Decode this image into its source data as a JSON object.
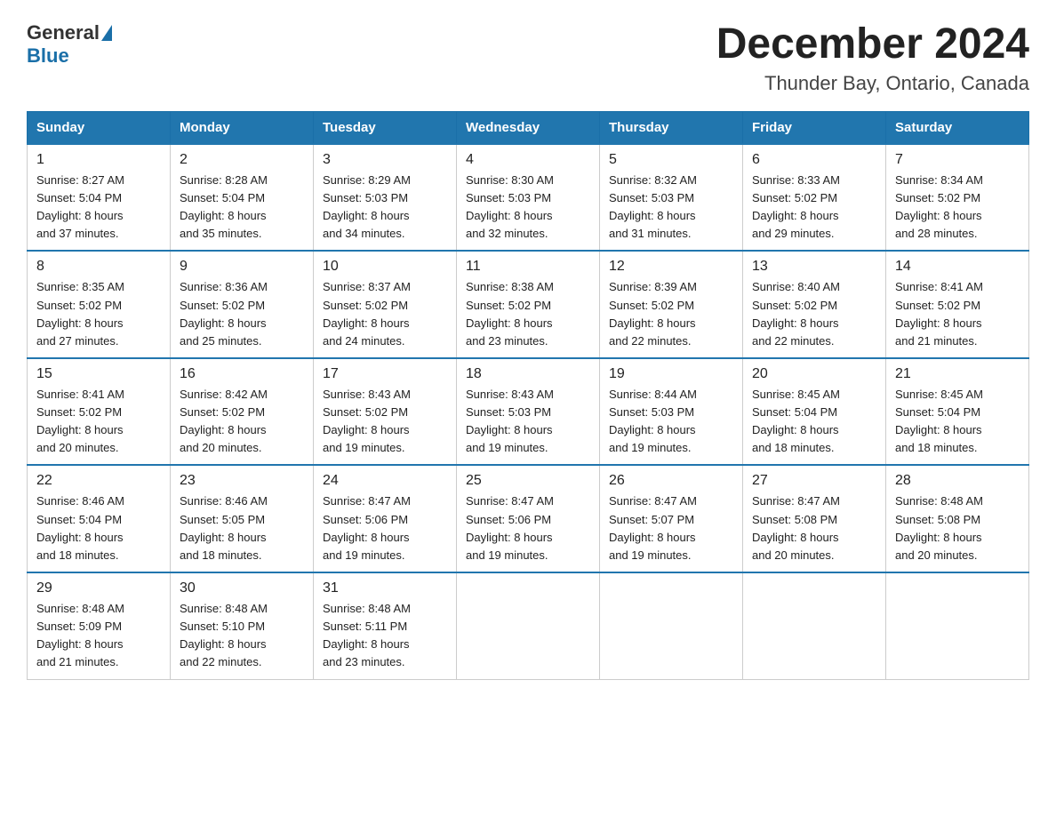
{
  "logo": {
    "general": "General",
    "blue": "Blue"
  },
  "title": "December 2024",
  "location": "Thunder Bay, Ontario, Canada",
  "weekdays": [
    "Sunday",
    "Monday",
    "Tuesday",
    "Wednesday",
    "Thursday",
    "Friday",
    "Saturday"
  ],
  "weeks": [
    [
      {
        "day": "1",
        "sunrise": "8:27 AM",
        "sunset": "5:04 PM",
        "daylight": "8 hours and 37 minutes."
      },
      {
        "day": "2",
        "sunrise": "8:28 AM",
        "sunset": "5:04 PM",
        "daylight": "8 hours and 35 minutes."
      },
      {
        "day": "3",
        "sunrise": "8:29 AM",
        "sunset": "5:03 PM",
        "daylight": "8 hours and 34 minutes."
      },
      {
        "day": "4",
        "sunrise": "8:30 AM",
        "sunset": "5:03 PM",
        "daylight": "8 hours and 32 minutes."
      },
      {
        "day": "5",
        "sunrise": "8:32 AM",
        "sunset": "5:03 PM",
        "daylight": "8 hours and 31 minutes."
      },
      {
        "day": "6",
        "sunrise": "8:33 AM",
        "sunset": "5:02 PM",
        "daylight": "8 hours and 29 minutes."
      },
      {
        "day": "7",
        "sunrise": "8:34 AM",
        "sunset": "5:02 PM",
        "daylight": "8 hours and 28 minutes."
      }
    ],
    [
      {
        "day": "8",
        "sunrise": "8:35 AM",
        "sunset": "5:02 PM",
        "daylight": "8 hours and 27 minutes."
      },
      {
        "day": "9",
        "sunrise": "8:36 AM",
        "sunset": "5:02 PM",
        "daylight": "8 hours and 25 minutes."
      },
      {
        "day": "10",
        "sunrise": "8:37 AM",
        "sunset": "5:02 PM",
        "daylight": "8 hours and 24 minutes."
      },
      {
        "day": "11",
        "sunrise": "8:38 AM",
        "sunset": "5:02 PM",
        "daylight": "8 hours and 23 minutes."
      },
      {
        "day": "12",
        "sunrise": "8:39 AM",
        "sunset": "5:02 PM",
        "daylight": "8 hours and 22 minutes."
      },
      {
        "day": "13",
        "sunrise": "8:40 AM",
        "sunset": "5:02 PM",
        "daylight": "8 hours and 22 minutes."
      },
      {
        "day": "14",
        "sunrise": "8:41 AM",
        "sunset": "5:02 PM",
        "daylight": "8 hours and 21 minutes."
      }
    ],
    [
      {
        "day": "15",
        "sunrise": "8:41 AM",
        "sunset": "5:02 PM",
        "daylight": "8 hours and 20 minutes."
      },
      {
        "day": "16",
        "sunrise": "8:42 AM",
        "sunset": "5:02 PM",
        "daylight": "8 hours and 20 minutes."
      },
      {
        "day": "17",
        "sunrise": "8:43 AM",
        "sunset": "5:02 PM",
        "daylight": "8 hours and 19 minutes."
      },
      {
        "day": "18",
        "sunrise": "8:43 AM",
        "sunset": "5:03 PM",
        "daylight": "8 hours and 19 minutes."
      },
      {
        "day": "19",
        "sunrise": "8:44 AM",
        "sunset": "5:03 PM",
        "daylight": "8 hours and 19 minutes."
      },
      {
        "day": "20",
        "sunrise": "8:45 AM",
        "sunset": "5:04 PM",
        "daylight": "8 hours and 18 minutes."
      },
      {
        "day": "21",
        "sunrise": "8:45 AM",
        "sunset": "5:04 PM",
        "daylight": "8 hours and 18 minutes."
      }
    ],
    [
      {
        "day": "22",
        "sunrise": "8:46 AM",
        "sunset": "5:04 PM",
        "daylight": "8 hours and 18 minutes."
      },
      {
        "day": "23",
        "sunrise": "8:46 AM",
        "sunset": "5:05 PM",
        "daylight": "8 hours and 18 minutes."
      },
      {
        "day": "24",
        "sunrise": "8:47 AM",
        "sunset": "5:06 PM",
        "daylight": "8 hours and 19 minutes."
      },
      {
        "day": "25",
        "sunrise": "8:47 AM",
        "sunset": "5:06 PM",
        "daylight": "8 hours and 19 minutes."
      },
      {
        "day": "26",
        "sunrise": "8:47 AM",
        "sunset": "5:07 PM",
        "daylight": "8 hours and 19 minutes."
      },
      {
        "day": "27",
        "sunrise": "8:47 AM",
        "sunset": "5:08 PM",
        "daylight": "8 hours and 20 minutes."
      },
      {
        "day": "28",
        "sunrise": "8:48 AM",
        "sunset": "5:08 PM",
        "daylight": "8 hours and 20 minutes."
      }
    ],
    [
      {
        "day": "29",
        "sunrise": "8:48 AM",
        "sunset": "5:09 PM",
        "daylight": "8 hours and 21 minutes."
      },
      {
        "day": "30",
        "sunrise": "8:48 AM",
        "sunset": "5:10 PM",
        "daylight": "8 hours and 22 minutes."
      },
      {
        "day": "31",
        "sunrise": "8:48 AM",
        "sunset": "5:11 PM",
        "daylight": "8 hours and 23 minutes."
      },
      null,
      null,
      null,
      null
    ]
  ],
  "labels": {
    "sunrise": "Sunrise:",
    "sunset": "Sunset:",
    "daylight": "Daylight:"
  }
}
